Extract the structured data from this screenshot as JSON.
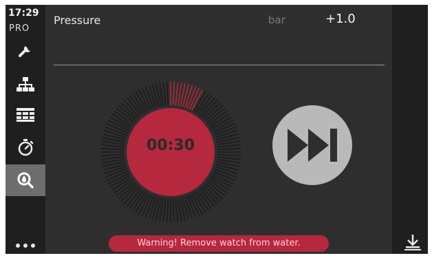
{
  "status": {
    "time": "17:29",
    "mode": "PRO"
  },
  "sidebar": {
    "items": [
      {
        "icon": "wrench-icon",
        "active": false
      },
      {
        "icon": "network-icon",
        "active": false
      },
      {
        "icon": "grid-icon",
        "active": false
      },
      {
        "icon": "stopwatch-icon",
        "active": false
      },
      {
        "icon": "dive-search-icon",
        "active": true
      }
    ],
    "more_icon": "more-dots-icon"
  },
  "header": {
    "label": "Pressure",
    "unit": "bar",
    "value": "+1.0"
  },
  "timer": {
    "display": "00:30",
    "progress": 0.083
  },
  "skip_icon": "skip-forward-icon",
  "warning": "Warning! Remove watch from water.",
  "download_icon": "download-icon",
  "colors": {
    "accent": "#b5283d",
    "background": "#2e2e2e",
    "sidebar": "#1f1f1f"
  }
}
